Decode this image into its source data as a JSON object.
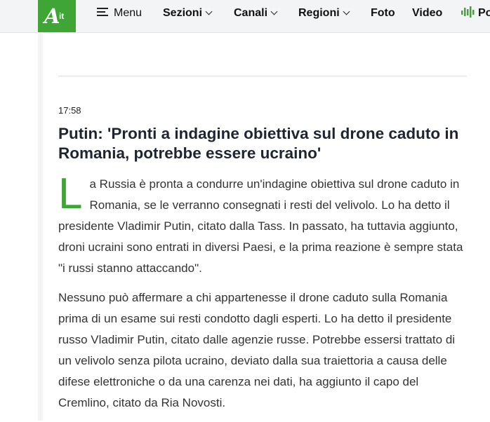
{
  "header": {
    "logo": {
      "letter": "A",
      "suffix": "it"
    },
    "menu_label": "Menu",
    "nav": [
      {
        "label": "Sezioni",
        "dropdown": true
      },
      {
        "label": "Canali",
        "dropdown": true
      },
      {
        "label": "Regioni",
        "dropdown": true
      },
      {
        "label": "Foto",
        "dropdown": false
      },
      {
        "label": "Video",
        "dropdown": false
      },
      {
        "label": "Po",
        "icon": "podcast-bars-icon"
      }
    ]
  },
  "article": {
    "time": "17:58",
    "title": "Putin: 'Pronti a indagine obiettiva sul drone caduto in Romania, potrebbe essere ucraino'",
    "dropcap": "L",
    "paragraphs": [
      "a Russia è pronta a condurre un'indagine obiettiva sul drone caduto in Romania, se le verranno consegnati i resti del velivolo. Lo ha detto il presidente Vladimir Putin, citato dalla Tass. In passato, ha tuttavia aggiunto, droni ucraini sono entrati in diversi Paesi, e la prima reazione è sempre stata \"i russi stanno attaccando\".",
      "Nessuno può affermare a chi appartenesse il drone caduto sulla Romania prima di un esame sui resti condotto dagli esperti. Lo ha detto il presidente russo Vladimir Putin, citato dalle agenzie russe. Potrebbe essersi trattato di un velivolo senza pilota ucraino, deviato dalla sua traiettoria a causa delle difese elettroniche o da una carenza nei dati, ha aggiunto il capo del Cremlino, citato da Ria Novosti."
    ]
  },
  "colors": {
    "brand_green": "#3fa535",
    "topbar_bg": "#f3f4f6",
    "headline": "#1e2430"
  }
}
